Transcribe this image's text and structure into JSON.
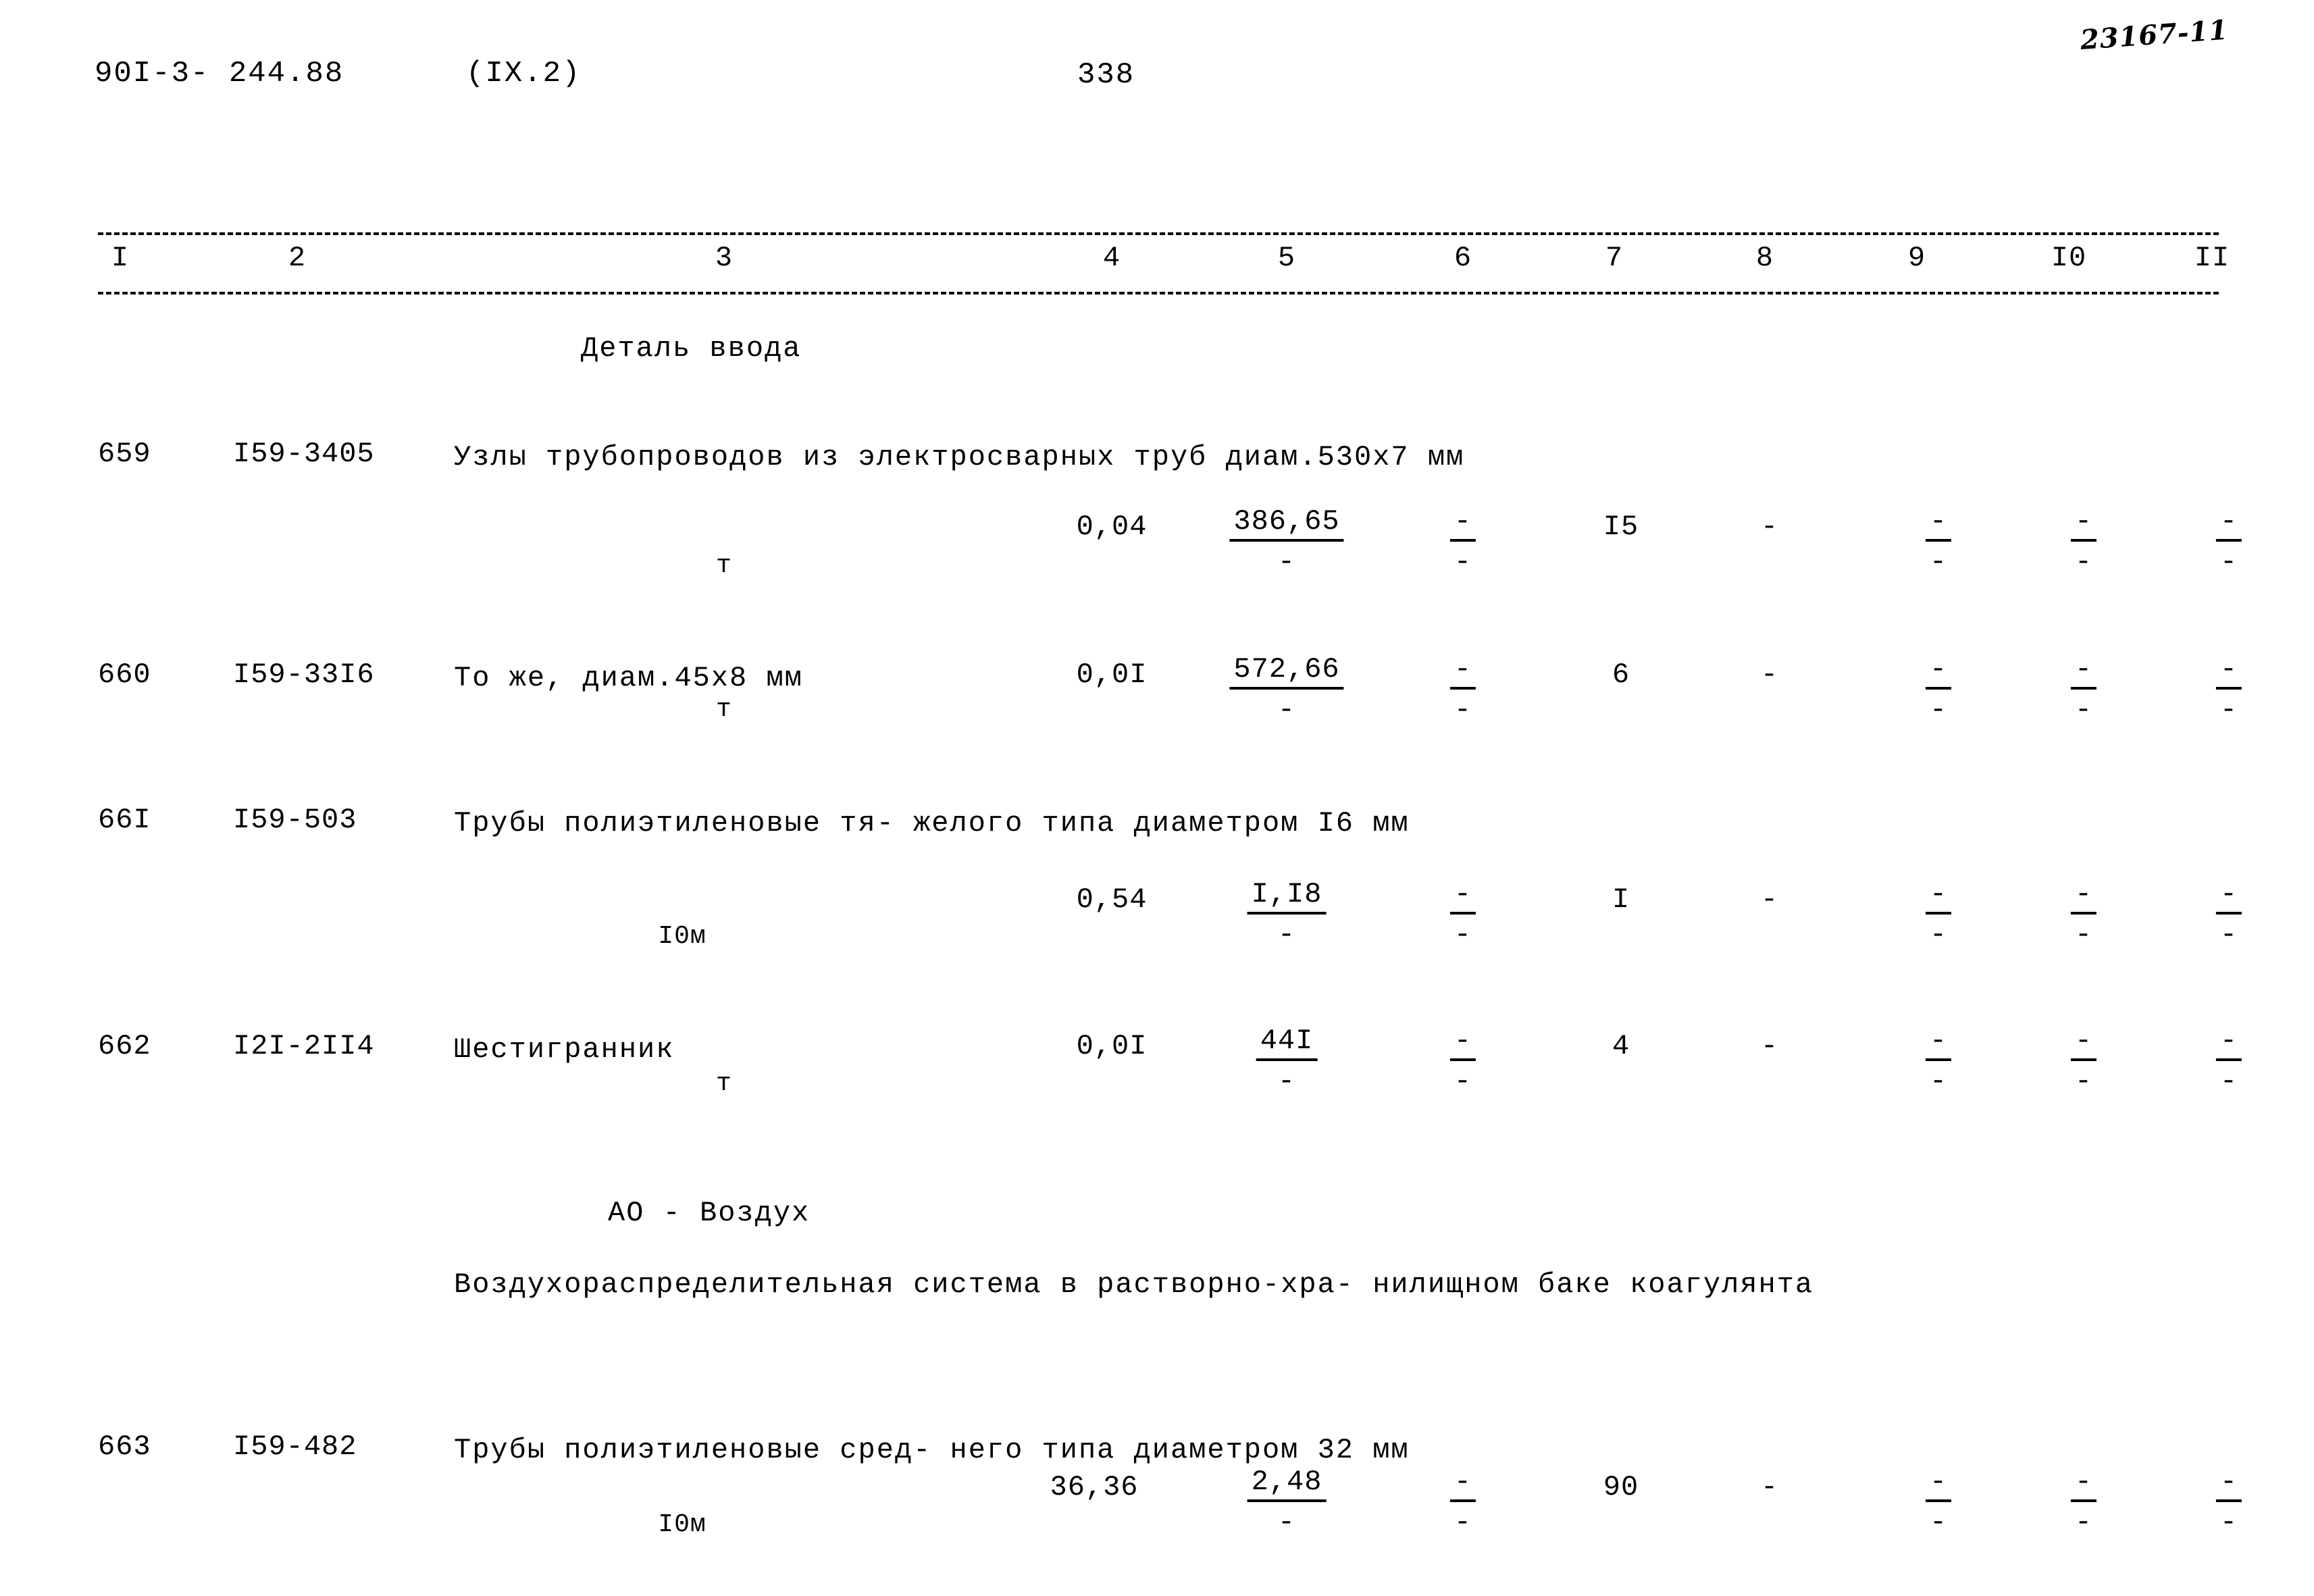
{
  "header": {
    "doc_code": "90I-3- 244.88",
    "section_ref": "(IX.2)",
    "page_number": "338",
    "archive_stamp": "23167-11"
  },
  "table": {
    "column_headers": [
      "I",
      "2",
      "3",
      "4",
      "5",
      "6",
      "7",
      "8",
      "9",
      "I0",
      "II"
    ],
    "sections": [
      {
        "title": "Деталь ввода"
      },
      {
        "title": "АО - Воздух"
      }
    ],
    "note": "Воздухораспределительная\nсистема в растворно-хра-\nнилищном баке коагулянта",
    "rows": [
      {
        "num": "659",
        "code": "I59-3405",
        "description": "Узлы трубопроводов из\nэлектросварных труб\nдиам.530х7 мм",
        "unit": "т",
        "c4": "0,04",
        "c5_num": "386,65",
        "c5_den": "-",
        "c6_num": "-",
        "c6_den": "-",
        "c7": "I5",
        "c8": "-",
        "c9_num": "-",
        "c9_den": "-",
        "c10_num": "-",
        "c10_den": "-",
        "c11_num": "-",
        "c11_den": "-"
      },
      {
        "num": "660",
        "code": "I59-33I6",
        "description": "То же, диам.45х8 мм",
        "unit": "т",
        "c4": "0,0I",
        "c5_num": "572,66",
        "c5_den": "-",
        "c6_num": "-",
        "c6_den": "-",
        "c7": "6",
        "c8": "-",
        "c9_num": "-",
        "c9_den": "-",
        "c10_num": "-",
        "c10_den": "-",
        "c11_num": "-",
        "c11_den": "-"
      },
      {
        "num": "66I",
        "code": "I59-503",
        "description": "Трубы полиэтиленовые тя-\nжелого типа диаметром\nI6 мм",
        "unit": "I0м",
        "c4": "0,54",
        "c5_num": "I,I8",
        "c5_den": "-",
        "c6_num": "-",
        "c6_den": "-",
        "c7": "I",
        "c8": "-",
        "c9_num": "-",
        "c9_den": "-",
        "c10_num": "-",
        "c10_den": "-",
        "c11_num": "-",
        "c11_den": "-"
      },
      {
        "num": "662",
        "code": "I2I-2II4",
        "description": "Шестигранник",
        "unit": "т",
        "c4": "0,0I",
        "c5_num": "44I",
        "c5_den": "-",
        "c6_num": "-",
        "c6_den": "-",
        "c7": "4",
        "c8": "-",
        "c9_num": "-",
        "c9_den": "-",
        "c10_num": "-",
        "c10_den": "-",
        "c11_num": "-",
        "c11_den": "-"
      },
      {
        "num": "663",
        "code": "I59-482",
        "description": "Трубы полиэтиленовые сред-\nнего типа диаметром 32 мм",
        "unit": "I0м",
        "c4": "36,36",
        "c5_num": "2,48",
        "c5_den": "-",
        "c6_num": "-",
        "c6_den": "-",
        "c7": "90",
        "c8": "-",
        "c9_num": "-",
        "c9_den": "-",
        "c10_num": "-",
        "c10_den": "-",
        "c11_num": "-",
        "c11_den": "-"
      }
    ]
  }
}
